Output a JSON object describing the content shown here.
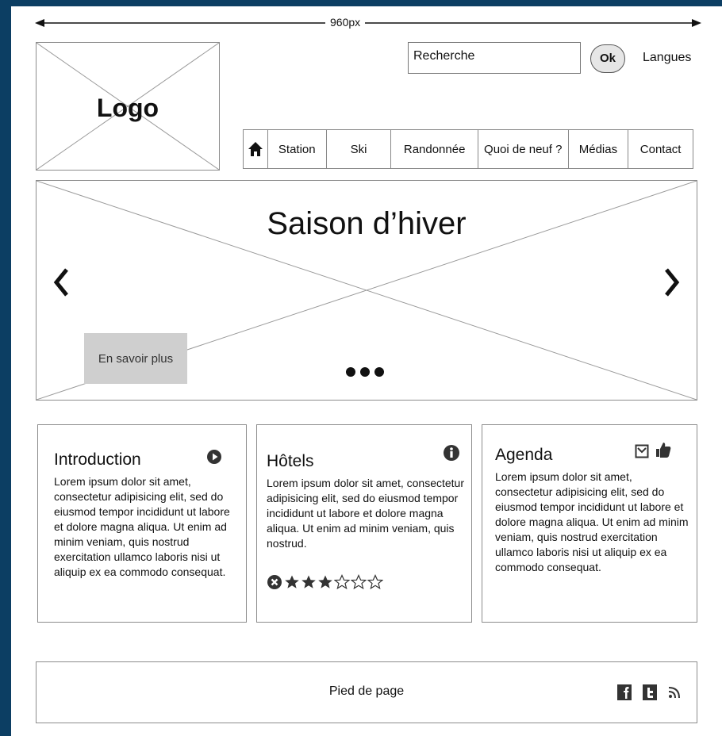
{
  "dimension_label": "960px",
  "header": {
    "logo": "Logo",
    "search_placeholder": "Recherche",
    "ok_label": "Ok",
    "languages_label": "Langues"
  },
  "nav": {
    "items": [
      "Station",
      "Ski",
      "Randonnée",
      "Quoi de neuf ?",
      "Médias",
      "Contact"
    ]
  },
  "hero": {
    "title": "Saison d’hiver",
    "cta": "En savoir plus",
    "prev_icon": "chevron-left-icon",
    "next_icon": "chevron-right-icon",
    "pager": "three-dots"
  },
  "cards": [
    {
      "title": "Introduction",
      "icon": "play-circle-icon",
      "text": "Lorem ipsum dolor sit amet, consectetur adipisicing elit, sed do eiusmod tempor incididunt ut labore et dolore magna aliqua. Ut enim ad minim veniam, quis nostrud exercitation ullamco laboris nisi ut aliquip ex ea commodo consequat."
    },
    {
      "title": "Hôtels",
      "icon": "info-icon",
      "text": "Lorem ipsum dolor sit amet, consectetur adipisicing elit, sed do eiusmod tempor incididunt ut labore et dolore magna aliqua. Ut enim ad minim veniam, quis nostrud.",
      "rating": {
        "value": 3,
        "max": 6
      }
    },
    {
      "title": "Agenda",
      "icons": [
        "checkbox-icon",
        "thumbs-up-icon"
      ],
      "text": "Lorem ipsum dolor sit amet, consectetur adipisicing elit, sed do eiusmod tempor incididunt ut labore et dolore magna aliqua. Ut enim ad minim veniam, quis nostrud exercitation ullamco laboris nisi ut aliquip ex ea commodo consequat."
    }
  ],
  "footer": {
    "text": "Pied de page",
    "icons": [
      "facebook-icon",
      "twitter-icon",
      "rss-icon"
    ]
  }
}
